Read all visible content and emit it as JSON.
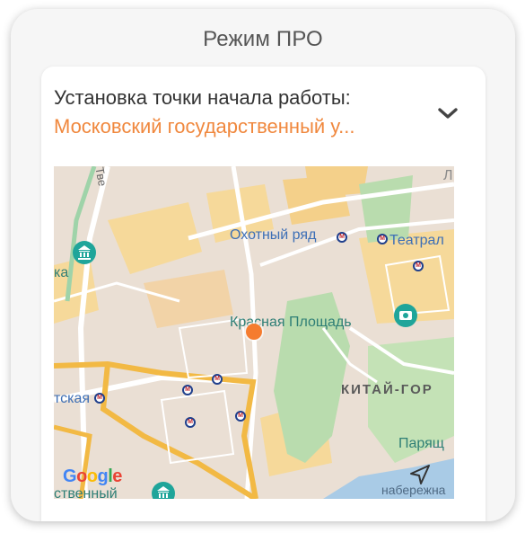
{
  "header": {
    "title": "Режим ПРО"
  },
  "start_point": {
    "label": "Установка точки начала работы:",
    "value": "Московский государственный у...",
    "accent_color": "#f0883e",
    "expand_icon": "chevron-down-icon"
  },
  "map": {
    "labels": {
      "okhotny_ryad": "Охотный ряд",
      "teatral": "Театрал",
      "krasnaya": "Красная Площадь",
      "kitay_gorod": "КИТАЙ-ГОР",
      "parysh": "Парящ",
      "embankment": "набережна",
      "tve": "Тве",
      "l": "Л",
      "ka": "ка",
      "skaya": "тская",
      "stvennyy": "ственный"
    },
    "logo_text": "Google",
    "marker_color": "#f57c2f"
  }
}
